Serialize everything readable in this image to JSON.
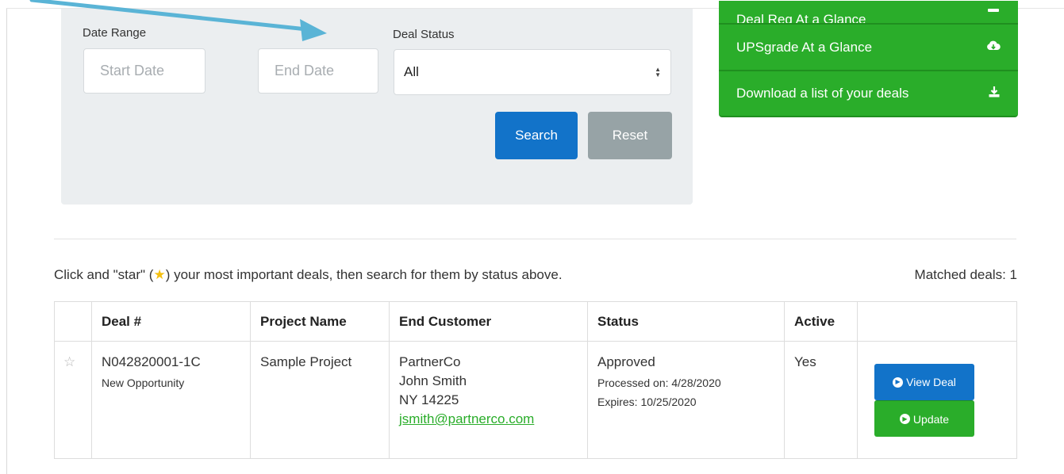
{
  "search_panel": {
    "date_range_label": "Date Range",
    "start_date_placeholder": "Start Date",
    "end_date_placeholder": "End Date",
    "deal_status_label": "Deal Status",
    "deal_status_value": "All",
    "search_label": "Search",
    "reset_label": "Reset"
  },
  "quick_links": [
    {
      "label": "Deal Reg At a Glance",
      "icon": "cloud-download-icon"
    },
    {
      "label": "UPSgrade At a Glance",
      "icon": "cloud-download-icon"
    },
    {
      "label": "Download a list of your deals",
      "icon": "download-icon"
    }
  ],
  "hint": {
    "before": "Click and \"star\" (",
    "after": ") your most important deals, then search for them by status above."
  },
  "matched_deals": "Matched deals: 1",
  "table": {
    "headers": [
      "",
      "Deal #",
      "Project Name",
      "End Customer",
      "Status",
      "Active",
      ""
    ],
    "row": {
      "deal_number": "N042820001-1C",
      "deal_type": "New Opportunity",
      "project_name": "Sample Project",
      "customer_company": "PartnerCo",
      "customer_name": "John Smith",
      "customer_location": "NY 14225",
      "customer_email": "jsmith@partnerco.com",
      "status": "Approved",
      "processed": "Processed on: 4/28/2020",
      "expires": "Expires: 10/25/2020",
      "active": "Yes",
      "view_label": "View Deal",
      "update_label": "Update"
    }
  },
  "colors": {
    "primary_blue": "#1273c9",
    "green": "#2aad2a",
    "reset_gray": "#97a3a6",
    "callout_arrow": "#5ab4d6",
    "star_gold": "#f5c010"
  }
}
